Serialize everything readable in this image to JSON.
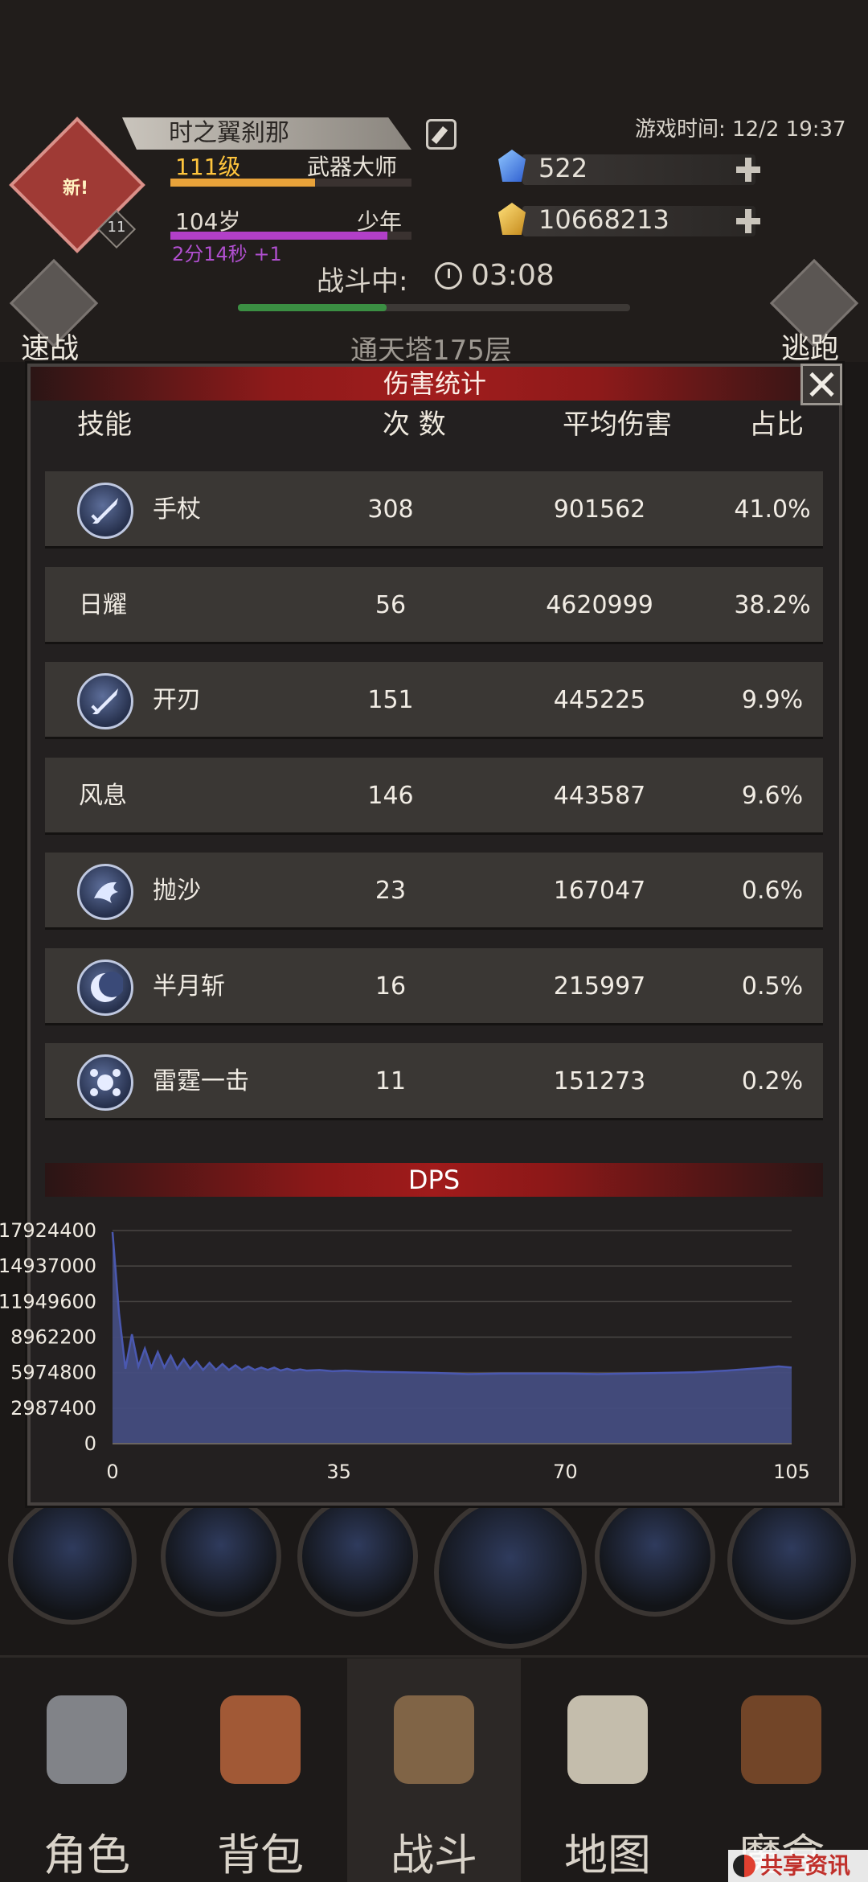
{
  "header": {
    "avatar_badge": "新!",
    "avatar_level": "11",
    "name": "时之翼刹那",
    "level": "111级",
    "class": "武器大师",
    "age": "104岁",
    "stage": "少年",
    "age_timer": "2分14秒 +1",
    "game_time": "游戏时间: 12/2 19:37",
    "gems": "522",
    "gold": "10668213",
    "exp_progress": 0.6,
    "age_progress": 0.9
  },
  "battle": {
    "status": "战斗中:",
    "timer": "03:08",
    "progress": 0.38,
    "floor": "通天塔175层",
    "quick_battle": "速战",
    "escape": "逃跑"
  },
  "panel": {
    "title": "伤害统计",
    "columns": {
      "skill": "技能",
      "count": "次 数",
      "avg": "平均伤害",
      "ratio": "占比"
    },
    "rows": [
      {
        "name": "手杖",
        "count": "308",
        "avg": "901562",
        "ratio": "41.0%",
        "icon": "sword-icon"
      },
      {
        "name": "日耀",
        "count": "56",
        "avg": "4620999",
        "ratio": "38.2%",
        "icon": ""
      },
      {
        "name": "开刃",
        "count": "151",
        "avg": "445225",
        "ratio": "9.9%",
        "icon": "sword-icon"
      },
      {
        "name": "风息",
        "count": "146",
        "avg": "443587",
        "ratio": "9.6%",
        "icon": ""
      },
      {
        "name": "抛沙",
        "count": "23",
        "avg": "167047",
        "ratio": "0.6%",
        "icon": "sand-icon"
      },
      {
        "name": "半月斩",
        "count": "16",
        "avg": "215997",
        "ratio": "0.5%",
        "icon": "crescent-icon"
      },
      {
        "name": "雷霆一击",
        "count": "11",
        "avg": "151273",
        "ratio": "0.2%",
        "icon": "thunder-icon"
      }
    ]
  },
  "chart_data": {
    "type": "area",
    "title": "DPS",
    "xlabel": "",
    "ylabel": "",
    "x_ticks": [
      "0",
      "35",
      "70",
      "105"
    ],
    "y_ticks": [
      "17924400",
      "14937000",
      "11949600",
      "8962200",
      "5974800",
      "2987400",
      "0"
    ],
    "xlim": [
      0,
      105
    ],
    "ylim": [
      0,
      17924400
    ],
    "grid": true,
    "series": [
      {
        "color": "#4a58b0",
        "x": [
          0,
          1,
          2,
          3,
          4,
          5,
          6,
          7,
          8,
          9,
          10,
          11,
          12,
          13,
          14,
          15,
          16,
          17,
          18,
          19,
          20,
          21,
          22,
          23,
          24,
          25,
          26,
          27,
          28,
          29,
          30,
          32,
          34,
          36,
          38,
          40,
          45,
          50,
          55,
          60,
          65,
          70,
          75,
          80,
          85,
          90,
          95,
          100,
          103,
          105
        ],
        "values": [
          17800000,
          11000000,
          6300000,
          9200000,
          6500000,
          8000000,
          6400000,
          7700000,
          6400000,
          7400000,
          6300000,
          7100000,
          6300000,
          6900000,
          6200000,
          6800000,
          6200000,
          6700000,
          6200000,
          6600000,
          6200000,
          6500000,
          6200000,
          6400000,
          6200000,
          6400000,
          6150000,
          6300000,
          6150000,
          6250000,
          6150000,
          6200000,
          6100000,
          6150000,
          6100000,
          6050000,
          6000000,
          5950000,
          5850000,
          5900000,
          5900000,
          5900000,
          5850000,
          5900000,
          5950000,
          6000000,
          6150000,
          6350000,
          6500000,
          6400000
        ]
      }
    ]
  },
  "nav": {
    "items": [
      {
        "label": "角色",
        "icon": "helmet-icon"
      },
      {
        "label": "背包",
        "icon": "backpack-icon"
      },
      {
        "label": "战斗",
        "icon": "sword-shield-icon"
      },
      {
        "label": "地图",
        "icon": "scroll-icon"
      },
      {
        "label": "魔盒",
        "icon": "magic-box-icon"
      }
    ],
    "active_index": 2
  },
  "watermark": "共享资讯网"
}
